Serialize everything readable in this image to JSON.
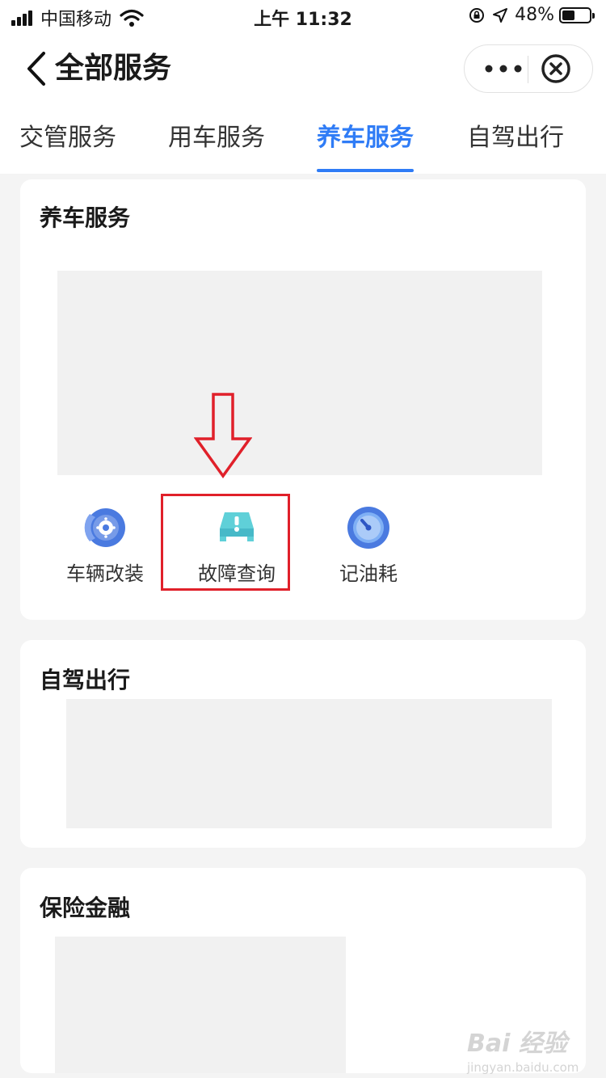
{
  "status_bar": {
    "carrier": "中国移动",
    "time": "上午 11:32",
    "battery_text": "48%",
    "battery_level": 0.48
  },
  "nav": {
    "title": "全部服务",
    "back_icon": "chevron-left-icon",
    "more_icon": "more-dots-icon",
    "close_icon": "close-circle-icon"
  },
  "tabs": [
    {
      "label": "交管服务",
      "active": false
    },
    {
      "label": "用车服务",
      "active": false
    },
    {
      "label": "养车服务",
      "active": true
    },
    {
      "label": "自驾出行",
      "active": false
    }
  ],
  "sections": [
    {
      "title": "养车服务",
      "services": [
        {
          "label": "车辆改装",
          "icon": "brake-disc-icon"
        },
        {
          "label": "故障查询",
          "icon": "car-warning-icon"
        },
        {
          "label": "记油耗",
          "icon": "stopwatch-icon"
        }
      ]
    },
    {
      "title": "自驾出行"
    },
    {
      "title": "保险金融"
    }
  ],
  "watermark": {
    "line1": "Bai 经验",
    "line2": "jingyan.baidu.com"
  },
  "colors": {
    "accent": "#2f7cf6",
    "highlight": "#e0202a",
    "background": "#f4f4f4"
  }
}
